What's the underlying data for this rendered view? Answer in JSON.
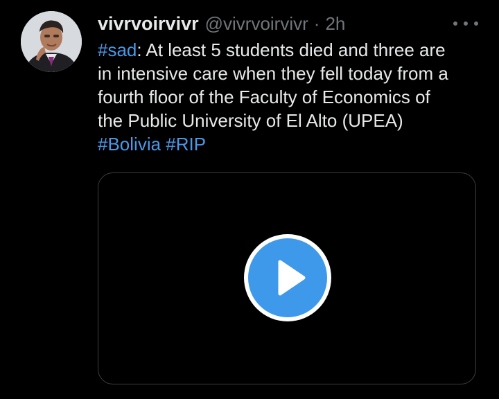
{
  "tweet": {
    "display_name": "vivrvoirvivr",
    "handle": "@vivrvoirvivr",
    "separator": "·",
    "time": "2h",
    "more_icon": "more-horizontal-icon",
    "text_lines": [
      {
        "hashtag": "#sad",
        "text": ": At least 5 students died and three are"
      },
      {
        "text": "in intensive care when they fell today from a"
      },
      {
        "text": "fourth floor of the Faculty of Economics of"
      },
      {
        "text": "the Public University of El Alto (UPEA)"
      },
      {
        "hashtags": [
          "#Bolivia",
          "#RIP"
        ]
      }
    ],
    "media": {
      "type": "video",
      "play_icon": "play-icon"
    }
  },
  "colors": {
    "background": "#000000",
    "text": "#e7e9ea",
    "muted": "#71767b",
    "hashtag": "#4a99e9",
    "media_border": "#3a3d41",
    "play_button": "#3e99ea"
  }
}
